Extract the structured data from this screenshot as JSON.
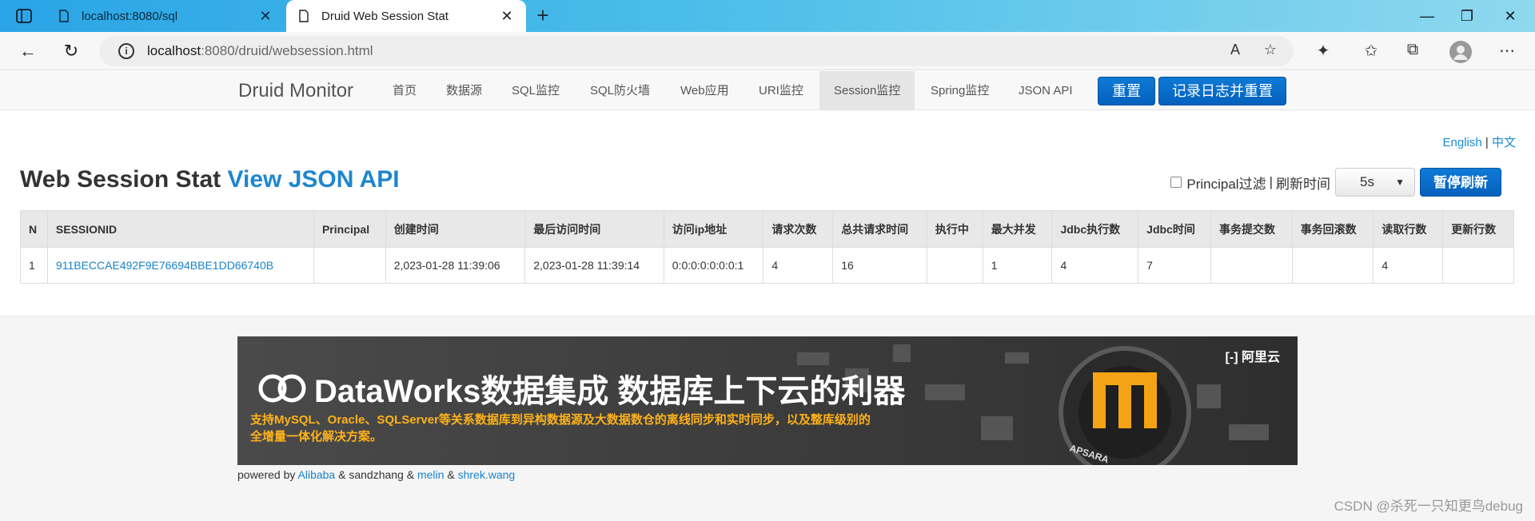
{
  "browser": {
    "tabs": [
      {
        "title": "localhost:8080/sql",
        "active": false
      },
      {
        "title": "Druid Web Session Stat",
        "active": true
      }
    ],
    "address": {
      "host": "localhost",
      "path": ":8080/druid/websession.html"
    }
  },
  "nav": {
    "brand": "Druid Monitor",
    "items": [
      "首页",
      "数据源",
      "SQL监控",
      "SQL防火墙",
      "Web应用",
      "URI监控",
      "Session监控",
      "Spring监控",
      "JSON API"
    ],
    "active": "Session监控",
    "reset_label": "重置",
    "log_reset_label": "记录日志并重置"
  },
  "lang": {
    "english": "English",
    "sep": "|",
    "chinese": "中文"
  },
  "page": {
    "title": "Web Session Stat",
    "api_link": "View JSON API",
    "principal_filter_label": "Principal过滤",
    "sep": "|",
    "refresh_label": "刷新时间",
    "refresh_value": "5s",
    "pause_label": "暂停刷新"
  },
  "table": {
    "headers": [
      "N",
      "SESSIONID",
      "Principal",
      "创建时间",
      "最后访问时间",
      "访问ip地址",
      "请求次数",
      "总共请求时间",
      "执行中",
      "最大并发",
      "Jdbc执行数",
      "Jdbc时间",
      "事务提交数",
      "事务回滚数",
      "读取行数",
      "更新行数"
    ],
    "rows": [
      [
        "1",
        "911BECCAE492F9E76694BBE1DD66740B",
        "",
        "2,023-01-28 11:39:06",
        "2,023-01-28 11:39:14",
        "0:0:0:0:0:0:0:1",
        "4",
        "16",
        "",
        "1",
        "4",
        "7",
        "",
        "",
        "4",
        ""
      ]
    ]
  },
  "banner": {
    "title": "DataWorks数据集成 数据库上下云的利器",
    "subtitle": "支持MySQL、Oracle、SQLServer等关系数据库到异构数据源及大数据数仓的离线同步和实时同步，以及整库级别的全增量一体化解决方案。",
    "brand": "阿里云",
    "apsara": "APSARA"
  },
  "footer": {
    "powered_by": "powered by",
    "alibaba": "Alibaba",
    "amp1": "&",
    "sandzhang": "sandzhang",
    "amp2": "&",
    "melin": "melin",
    "amp3": "&",
    "shrek": "shrek.wang"
  },
  "watermark": "CSDN @杀死一只知更鸟debug",
  "colors": {
    "accent": "#1e86d0",
    "button": "#0a6dcb",
    "banner_text": "#ffb21a"
  }
}
